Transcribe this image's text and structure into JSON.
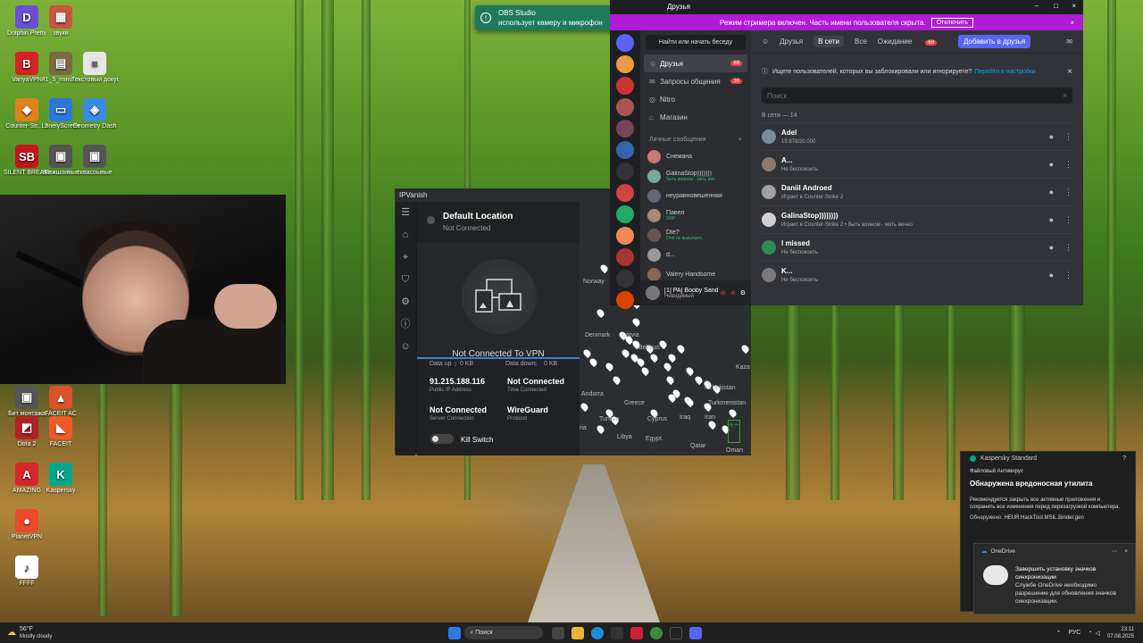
{
  "desktop": {
    "icons": [
      {
        "label": "Dolphin Pretty",
        "color": "#6b4fd6",
        "glyph": "D"
      },
      {
        "label": "звуки",
        "color": "#c8553d",
        "glyph": "▦"
      },
      {
        "label": "VanyaVPN",
        "color": "#d32323",
        "glyph": "B"
      },
      {
        "label": "#1_5_minut...",
        "color": "#7a6a40",
        "glyph": "▤"
      },
      {
        "label": "Текстовый документ (2)",
        "color": "#e6e6e6",
        "glyph": "≡"
      },
      {
        "label": "Counter-Str... 2",
        "color": "#e0821b",
        "glyph": "◆"
      },
      {
        "label": "LonelyScreen",
        "color": "#2c77d8",
        "glyph": "▭"
      },
      {
        "label": "Geometry Dash",
        "color": "#3b8be0",
        "glyph": "◈"
      },
      {
        "label": "SILENT BREATH",
        "color": "#c4161c",
        "glyph": "SB"
      },
      {
        "label": "вкажшоивые",
        "color": "#555",
        "glyph": "▣"
      },
      {
        "label": "сквасоывые",
        "color": "#555",
        "glyph": "▣"
      },
      {
        "label": "Бит монтажа",
        "color": "#555",
        "glyph": "▣"
      },
      {
        "label": "FACEIT AC",
        "color": "#d8542a",
        "glyph": "▲"
      },
      {
        "label": "Dota 2",
        "color": "#b22222",
        "glyph": "◩"
      },
      {
        "label": "FACEIT",
        "color": "#f25a24",
        "glyph": "◣"
      },
      {
        "label": "AMAZING",
        "color": "#d7262a",
        "glyph": "A"
      },
      {
        "label": "Kaspersky",
        "color": "#00a88e",
        "glyph": "K"
      },
      {
        "label": "PlanetVPN",
        "color": "#e84a2a",
        "glyph": "●"
      },
      {
        "label": "FFFF",
        "color": "#ffffff",
        "glyph": "♪"
      }
    ]
  },
  "obs_toast": {
    "app": "OBS Studio",
    "message": "использует камеру и микрофон",
    "chevron": "⌄",
    "close": "×"
  },
  "ipvanish": {
    "title": "IPVanish",
    "location_title": "Default Location",
    "location_status": "Not Connected",
    "connect_text": "Not Connected To VPN",
    "data_up_label": "Data up",
    "data_up_value": "0 KB",
    "data_down_label": "Data down",
    "data_down_value": "0 KB",
    "ip": "91.215.188.116",
    "ip_label": "Public IP Address",
    "time": "Not Connected",
    "time_label": "Time Connected",
    "server": "Not Connected",
    "server_label": "Server Connection",
    "protocol": "WireGuard",
    "protocol_label": "Protocol",
    "kill_switch": "Kill Switch",
    "map_labels": [
      "Norway",
      "Denmark",
      "Latvia",
      "Belarus",
      "Kaza",
      "Andorra",
      "Uzbekistan",
      "Greece",
      "Turkmenistan",
      "Tunisia",
      "Cyprus",
      "Iraq",
      "Iran",
      "Libya",
      "Egypt",
      "Qatar",
      "Oman",
      "ria"
    ]
  },
  "discord": {
    "window_title": "Друзья",
    "banner_text": "Режим стримера включен. Часть имени пользователя скрыта.",
    "banner_button": "Отключить",
    "search_button": "Найти или начать беседу",
    "nav": [
      {
        "label": "Друзья",
        "badge": "69"
      },
      {
        "label": "Запросы общения",
        "badge": "36"
      },
      {
        "label": "Nitro",
        "badge": ""
      },
      {
        "label": "Магазин",
        "badge": ""
      }
    ],
    "dm_header": "Личные сообщения",
    "dm_add": "+",
    "dms": [
      {
        "name": "Снежана",
        "sub": ""
      },
      {
        "name": "GalinaStop)))))))",
        "sub": "быть воином - жить веч"
      },
      {
        "name": "неуравновешенная",
        "sub": ""
      },
      {
        "name": "Павел",
        "sub": "SRP"
      },
      {
        "name": "Dte?",
        "sub": "Они не выкупают,"
      },
      {
        "name": "d...",
        "sub": ""
      },
      {
        "name": "Valery Handsome",
        "sub": ""
      }
    ],
    "user_name": "[1] PA] Booby Sand...",
    "user_status": "Невидимый",
    "tabs": {
      "friends": "Друзья",
      "online": "В сети",
      "all": "Все",
      "pending": "Ожидание",
      "pending_badge": "69",
      "add": "Добавить в друзья"
    },
    "notice": "Ищете пользователей, которых вы заблокировали или игнорируете?",
    "notice_link": "Перейти в настройки",
    "search_placeholder": "Поиск",
    "online_header": "В сети — 14",
    "friends": [
      {
        "name": "Adel",
        "status": "19.878/20.000",
        "color": "#7b8b9a"
      },
      {
        "name": "A...",
        "status": "Не беспокоить",
        "color": "#8b7a6a"
      },
      {
        "name": "Daniil Androed",
        "status": "Играет в Counter-Strike 2",
        "color": "#a0a0a0"
      },
      {
        "name": "GalinaStop))))))))",
        "status": "Играет в Counter-Strike 2 • быть воином - жить вечно",
        "color": "#d0d0d0"
      },
      {
        "name": "I missed",
        "status": "Не беспокоить",
        "color": "#2e8b57"
      },
      {
        "name": "K...",
        "status": "Не беспокоить",
        "color": "#7a7a7a"
      }
    ]
  },
  "kaspersky": {
    "app": "Kaspersky Standard",
    "module": "Файловый Антивирус",
    "heading": "Обнаружена вредоносная утилита",
    "body": "Рекомендуется закрыть все активные приложения и сохранить все изменения перед перезагрузкой компьютера.",
    "detected_label": "Обнаружено:",
    "detected_value": "HEUR:HackTool.MSIL.Binder.gen",
    "help": "?"
  },
  "onedrive": {
    "app": "OneDrive",
    "title": "Завершить установку значков синхронизации",
    "body": "Службе OneDrive необходимо разрешение для обновления значков синхронизации."
  },
  "taskbar": {
    "weather_temp": "56°F",
    "weather_desc": "Mostly cloudy",
    "search": "Поиск",
    "lang": "РУС",
    "time": "23:11",
    "date": "07.08.2025"
  }
}
